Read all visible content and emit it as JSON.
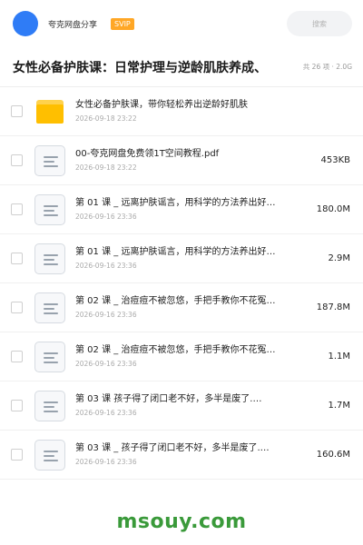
{
  "header": {
    "user_name": "夸克网盘分享",
    "badge": "SVIP",
    "search_placeholder": "搜索"
  },
  "page": {
    "title": "女性必备护肤课：日常护理与逆龄肌肤养成、",
    "meta": "共 26 项 · 2.0G"
  },
  "files": [
    {
      "type": "folder",
      "name": "女性必备护肤课，带你轻松养出逆龄好肌肤",
      "date": "2026-09-18 23:22",
      "size": ""
    },
    {
      "type": "doc",
      "name": "00-夸克网盘免费领1T空间教程.pdf",
      "date": "2026-09-18 23:22",
      "size": "453KB"
    },
    {
      "type": "doc",
      "name": "第 01 课 _ 远离护肤谣言，用科学的方法养出好…",
      "date": "2026-09-16 23:36",
      "size": "180.0M"
    },
    {
      "type": "doc",
      "name": "第 01 课 _ 远离护肤谣言，用科学的方法养出好…",
      "date": "2026-09-16 23:36",
      "size": "2.9M"
    },
    {
      "type": "doc",
      "name": "第 02 课 _ 治痘痘不被忽悠，手把手教你不花冤…",
      "date": "2026-09-16 23:36",
      "size": "187.8M"
    },
    {
      "type": "doc",
      "name": "第 02 课 _ 治痘痘不被忽悠，手把手教你不花冤…",
      "date": "2026-09-16 23:36",
      "size": "1.1M"
    },
    {
      "type": "doc",
      "name": "第 03 课 孩子得了闭口老不好，多半是废了.…",
      "date": "2026-09-16 23:36",
      "size": "1.7M"
    },
    {
      "type": "doc",
      "name": "第 03 课 _ 孩子得了闭口老不好，多半是废了.…",
      "date": "2026-09-16 23:36",
      "size": "160.6M"
    }
  ],
  "watermark": "msouy.com",
  "colors": {
    "avatar": "#2f7cf6",
    "svip_badge": "#ffa726",
    "folder": "#ffbf00",
    "watermark": "#3a9a3a"
  },
  "icons": {
    "folder": "folder-icon",
    "doc": "document-icon"
  }
}
